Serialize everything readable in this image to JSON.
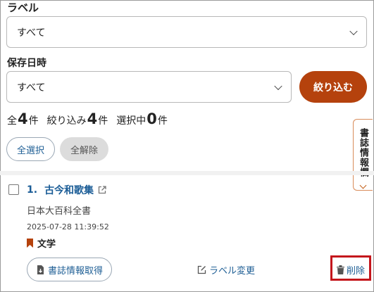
{
  "filters": {
    "label_title": "ラベル",
    "label_select_value": "すべて",
    "date_title": "保存日時",
    "date_select_value": "すべて",
    "filter_button": "絞り込む"
  },
  "counts": {
    "total_prefix": "全",
    "total_value": "4",
    "total_suffix": "件",
    "filtered_prefix": "絞り込み",
    "filtered_value": "4",
    "filtered_suffix": "件",
    "selected_prefix": "選択中",
    "selected_value": "0",
    "selected_suffix": "件"
  },
  "bulk": {
    "select_all": "全選択",
    "clear_all": "全解除"
  },
  "side_tab": {
    "label": "書誌情報欄"
  },
  "item": {
    "number": "1.",
    "title": "古今和歌集",
    "source": "日本大百科全書",
    "saved_at": "2025-07-28 11:39:52",
    "tag": "文学",
    "fetch_button": "書誌情報取得",
    "label_change": "ラベル変更",
    "delete": "削除"
  },
  "colors": {
    "accent": "#b5420d",
    "link": "#1f5f95",
    "tag_bookmark": "#b5420d",
    "highlight": "#c4161c"
  },
  "icons": [
    "chevron-down-icon",
    "external-link-icon",
    "bookmark-icon",
    "download-icon",
    "edit-icon",
    "trash-icon"
  ]
}
